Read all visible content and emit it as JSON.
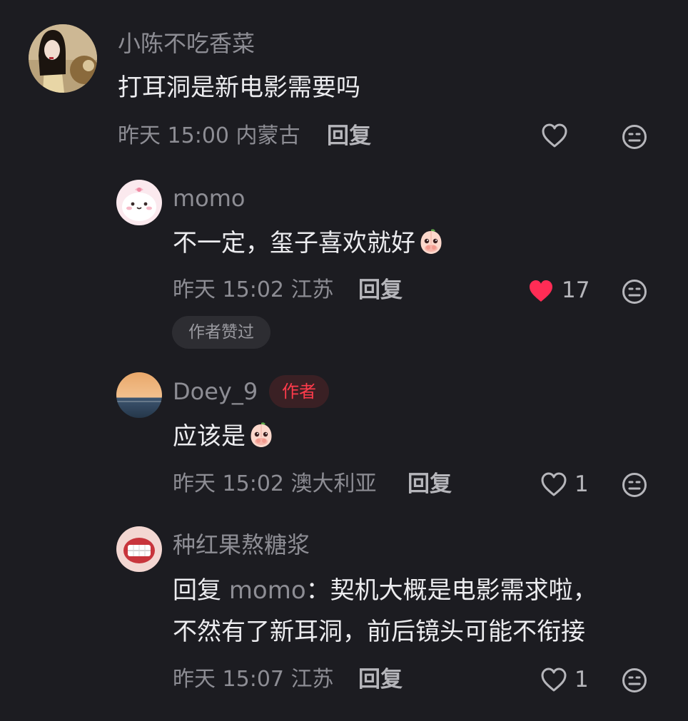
{
  "comments": [
    {
      "username": "小陈不吃香菜",
      "text": "打耳洞是新电影需要吗",
      "time": "昨天 15:00",
      "location": "内蒙古",
      "reply_label": "回复"
    },
    {
      "username": "momo",
      "text": "不一定，玺子喜欢就好",
      "time": "昨天 15:02",
      "location": "江苏",
      "reply_label": "回复",
      "likes": "17",
      "liked": true,
      "badge": "作者赞过"
    },
    {
      "username": "Doey_9",
      "author_tag": "作者",
      "text": "应该是",
      "time": "昨天 15:02",
      "location": "澳大利亚",
      "reply_label": "回复",
      "likes": "1"
    },
    {
      "username": "种红果熬糖浆",
      "reply_prefix": "回复",
      "reply_to": "momo",
      "reply_colon": "：",
      "text_line1": "契机大概是电影需求啦，",
      "text_line2": "不然有了新耳洞，前后镜头可能不衔接",
      "time": "昨天 15:07",
      "location": "江苏",
      "reply_label": "回复",
      "likes": "1"
    }
  ],
  "icons": {
    "like": "heart-outline-icon",
    "liked": "heart-filled-icon",
    "dislike": "meh-face-icon",
    "emoji": "peach-covering-mouth-emoji"
  },
  "colors": {
    "background": "#1c1c21",
    "liked_heart": "#ff2c55",
    "author_tag": "#ff3b4b"
  }
}
